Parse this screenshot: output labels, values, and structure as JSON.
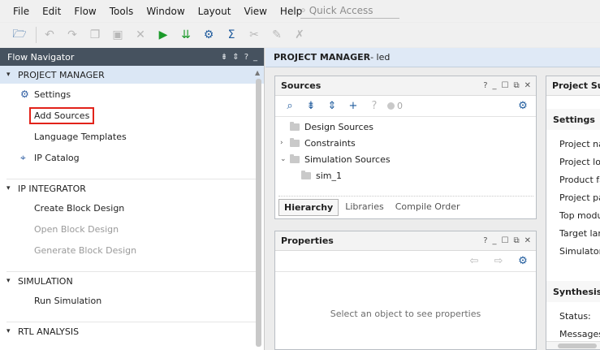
{
  "menu": [
    "File",
    "Edit",
    "Flow",
    "Tools",
    "Window",
    "Layout",
    "View",
    "Help"
  ],
  "quick_access": {
    "placeholder": "Quick Access",
    "icon": "search-icon"
  },
  "toolbar": {
    "icons": [
      "open-project-icon",
      "undo-icon",
      "redo-icon",
      "copy-icon",
      "paste-icon",
      "delete-icon",
      "run-icon",
      "program-device-icon",
      "settings-icon",
      "sigma-icon",
      "tool-icon-1",
      "tool-icon-2",
      "close-tool-icon"
    ]
  },
  "flow_navigator": {
    "title": "Flow Navigator",
    "sections": [
      {
        "label": "PROJECT MANAGER",
        "items": [
          {
            "label": "Settings",
            "icon": "gear-icon",
            "disabled": false
          },
          {
            "label": "Add Sources",
            "icon": "",
            "disabled": false,
            "highlighted": true
          },
          {
            "label": "Language Templates",
            "icon": "",
            "disabled": false
          },
          {
            "label": "IP Catalog",
            "icon": "ip-catalog-icon",
            "disabled": false
          }
        ]
      },
      {
        "label": "IP INTEGRATOR",
        "items": [
          {
            "label": "Create Block Design",
            "disabled": false
          },
          {
            "label": "Open Block Design",
            "disabled": true
          },
          {
            "label": "Generate Block Design",
            "disabled": true
          }
        ]
      },
      {
        "label": "SIMULATION",
        "items": [
          {
            "label": "Run Simulation",
            "disabled": false
          }
        ]
      },
      {
        "label": "RTL ANALYSIS",
        "items": []
      }
    ]
  },
  "main_header": {
    "title": "PROJECT MANAGER",
    "project": " - led"
  },
  "sources": {
    "title": "Sources",
    "count": "0",
    "tree": [
      {
        "label": "Design Sources",
        "expand": ""
      },
      {
        "label": "Constraints",
        "expand": "›"
      },
      {
        "label": "Simulation Sources",
        "expand": "⌄"
      },
      {
        "label": "sim_1",
        "expand": "",
        "child": true
      }
    ],
    "tabs": [
      "Hierarchy",
      "Libraries",
      "Compile Order"
    ]
  },
  "properties": {
    "title": "Properties",
    "empty_message": "Select an object to see properties"
  },
  "summary": {
    "title": "Project Sum",
    "settings_label": "Settings",
    "fields": [
      "Project nar",
      "Project loca",
      "Product far",
      "Project par",
      "Top modul",
      "Target lang",
      "Simulator l"
    ],
    "synthesis_label": "Synthesis",
    "synthesis_fields": [
      "Status:",
      "Messages:"
    ]
  },
  "colors": {
    "nav_header": "#46525f",
    "active_section": "#dbe7f5",
    "highlight_border": "#e2231a",
    "accent": "#1e5a9c"
  }
}
